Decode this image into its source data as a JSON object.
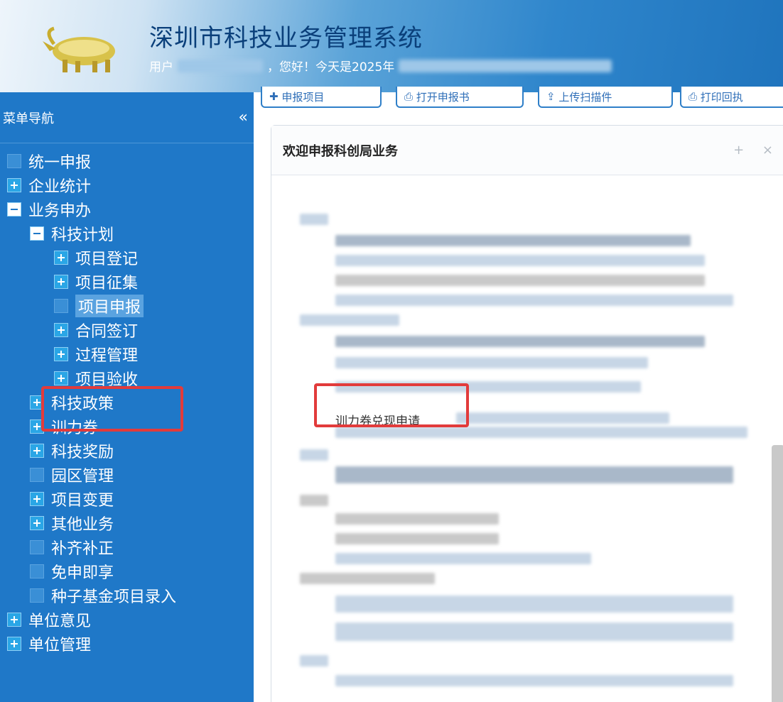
{
  "header": {
    "system_title": "深圳市科技业务管理系统",
    "user_prefix": "用户",
    "greeting": "，您好！今天是2025年"
  },
  "sidebar": {
    "title": "菜单导航",
    "collapse": "«",
    "items": [
      {
        "label": "统一申报",
        "icon": "plain",
        "level": 0
      },
      {
        "label": "企业统计",
        "icon": "plus",
        "level": 0
      },
      {
        "label": "业务申办",
        "icon": "minus",
        "level": 0
      },
      {
        "label": "科技计划",
        "icon": "minus",
        "level": 1
      },
      {
        "label": "项目登记",
        "icon": "plus",
        "level": 2
      },
      {
        "label": "项目征集",
        "icon": "plus",
        "level": 2
      },
      {
        "label": "项目申报",
        "icon": "plain",
        "level": 2,
        "selected": true
      },
      {
        "label": "合同签订",
        "icon": "plus",
        "level": 2
      },
      {
        "label": "过程管理",
        "icon": "plus",
        "level": 2
      },
      {
        "label": "项目验收",
        "icon": "plus",
        "level": 2
      },
      {
        "label": "科技政策",
        "icon": "plus",
        "level": 1
      },
      {
        "label": "训力券",
        "icon": "plus",
        "level": 1
      },
      {
        "label": "科技奖励",
        "icon": "plus",
        "level": 1
      },
      {
        "label": "园区管理",
        "icon": "plain",
        "level": 1
      },
      {
        "label": "项目变更",
        "icon": "plus",
        "level": 1
      },
      {
        "label": "其他业务",
        "icon": "plus",
        "level": 1
      },
      {
        "label": "补齐补正",
        "icon": "plain",
        "level": 1
      },
      {
        "label": "免申即享",
        "icon": "plain",
        "level": 1
      },
      {
        "label": "种子基金项目录入",
        "icon": "plain",
        "level": 1
      },
      {
        "label": "单位意见",
        "icon": "plus",
        "level": 0
      },
      {
        "label": "单位管理",
        "icon": "plus",
        "level": 0
      }
    ]
  },
  "toolbar": {
    "buttons": [
      "申报项目",
      "打开申报书",
      "上传扫描件",
      "打印回执"
    ]
  },
  "panel": {
    "title": "欢迎申报科创局业务",
    "tools": "+ ×",
    "link": "训力券兑现申请"
  },
  "colors": {
    "sidebar_bg": "#1f78c8",
    "highlight_red": "#e23b3b",
    "title_color": "#0a3f7a"
  }
}
